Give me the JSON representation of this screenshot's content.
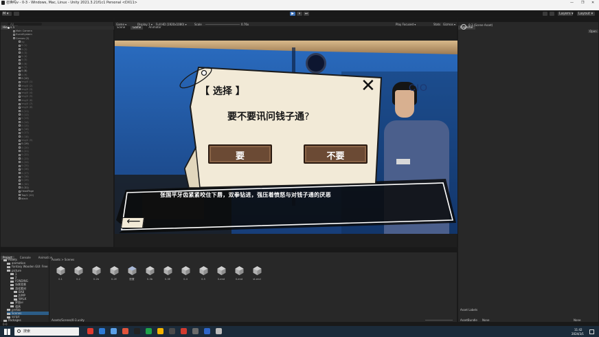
{
  "window": {
    "title": "召唤吗v - 0-3 - Windows, Mac, Linux - Unity 2021.3.21f1c1 Personal <DX11>",
    "controls": [
      "—",
      "❐",
      "✕"
    ]
  },
  "menu": [
    "File",
    "Edit",
    "Assets",
    "GameObject",
    "Component",
    "Jobs",
    "Window",
    "Help"
  ],
  "toolbar": {
    "account": "M ▾",
    "play": "▶",
    "pause": "⏸",
    "step": "⏭",
    "layers": "Layers ▾",
    "layout": "Layout ▾"
  },
  "hierarchy": {
    "tab": "Hierarchy",
    "search_placeholder": "All",
    "scene": "0-3",
    "rows": [
      {
        "label": "Main Camera",
        "dim": false
      },
      {
        "label": "EventSystem",
        "dim": false
      },
      {
        "label": "Canvas (2)",
        "dim": false
      },
      {
        "label": "bg",
        "dim": true
      },
      {
        "label": "0 (1)",
        "dim": true
      },
      {
        "label": "0 (2)",
        "dim": true
      },
      {
        "label": "0 (3)",
        "dim": true
      },
      {
        "label": "0 (4)",
        "dim": true
      },
      {
        "label": "0 (5)",
        "dim": true
      },
      {
        "label": "0 (6)",
        "dim": true
      },
      {
        "label": "0 (7)",
        "dim": true
      },
      {
        "label": "0 (8)",
        "dim": false
      },
      {
        "label": "0 (9)",
        "dim": true
      },
      {
        "label": "0 (10)",
        "dim": false
      },
      {
        "label": "Img/0 (1)",
        "dim": true
      },
      {
        "label": "Img/0 (2)",
        "dim": true
      },
      {
        "label": "Img/0 (3)",
        "dim": true
      },
      {
        "label": "Img/0 (4)",
        "dim": true
      },
      {
        "label": "Img/0 (5)",
        "dim": true
      },
      {
        "label": "Img/0 (6)",
        "dim": true
      },
      {
        "label": "Img/0 (7)",
        "dim": true
      },
      {
        "label": "Img/0 (8)",
        "dim": true
      },
      {
        "label": "0 (11)",
        "dim": true
      },
      {
        "label": "0 (12)",
        "dim": true
      },
      {
        "label": "0 (13)",
        "dim": true
      },
      {
        "label": "0 (14)",
        "dim": true
      },
      {
        "label": "0 (15)",
        "dim": true
      },
      {
        "label": "0 (16)",
        "dim": true
      },
      {
        "label": "0 (17)",
        "dim": true
      },
      {
        "label": "0 (18)",
        "dim": true
      },
      {
        "label": "Img/0 (9)",
        "dim": true
      },
      {
        "label": "0 (19)",
        "dim": false
      },
      {
        "label": "0 (20)",
        "dim": true
      },
      {
        "label": "0 (21)",
        "dim": true
      },
      {
        "label": "0 (22)",
        "dim": true
      },
      {
        "label": "0 (23)",
        "dim": true
      },
      {
        "label": "0 (24)",
        "dim": true
      },
      {
        "label": "0 (25)",
        "dim": true
      },
      {
        "label": "0 (26)",
        "dim": true
      },
      {
        "label": "0 (27)",
        "dim": true
      },
      {
        "label": "0 (28)",
        "dim": true
      },
      {
        "label": "0 (29)",
        "dim": true
      },
      {
        "label": "0 (30)",
        "dim": true
      },
      {
        "label": "0 (31)",
        "dim": false
      },
      {
        "label": "HeadPage",
        "dim": false
      },
      {
        "label": "Tap/1 (12)",
        "dim": false
      },
      {
        "label": "black",
        "dim": false
      }
    ]
  },
  "center": {
    "tabs": [
      "Scene",
      "Game",
      "Animator"
    ],
    "game_toolbar": {
      "display": "Game ▾",
      "display_no": "Display 1 ▾",
      "resolution": "Full HD (1920x1080) ▾",
      "scale_label": "Scale",
      "scale_value": "0.76x",
      "play_mode": "Play Focused ▾",
      "stats": "Stats",
      "gizmos": "Gizmos ▾"
    }
  },
  "game": {
    "dialog": {
      "title": "【 选择 】",
      "question": "要不要讯问钱子通",
      "question_mark": "?",
      "yes": "要",
      "no": "不要",
      "close": "✕"
    },
    "narration": "张国平牙齿紧紧咬住下唇，双拳钻进，强压着愤怒与对钱子通的厌恶",
    "back": "⟵",
    "wall_text": "CIO"
  },
  "inspector": {
    "tab": "Inspector",
    "object": "0-3 (Scene Asset)",
    "open": "Open",
    "asset_labels": "Asset Labels",
    "asset_bundle": "AssetBundle",
    "bundle_value": "None",
    "variant": "None"
  },
  "project": {
    "tabs": [
      "Project",
      "Console",
      "Animation"
    ],
    "breadcrumb": "Assets > Scenes",
    "tree": [
      {
        "label": "Assets",
        "level": 0
      },
      {
        "label": "animation",
        "level": 1
      },
      {
        "label": "Fantasy Wooden GUI: Free",
        "level": 1
      },
      {
        "label": "picture",
        "level": 1
      },
      {
        "label": "1",
        "level": 2
      },
      {
        "label": "2",
        "level": 2
      },
      {
        "label": "FONDING",
        "level": 2
      },
      {
        "label": "场景背景",
        "level": 2
      },
      {
        "label": "游戏素材",
        "level": 2
      },
      {
        "label": "BAB",
        "level": 3
      },
      {
        "label": "JUMP",
        "level": 3
      },
      {
        "label": "WALK",
        "level": 3
      },
      {
        "label": "界面ui",
        "level": 2
      },
      {
        "label": "道具",
        "level": 2
      },
      {
        "label": "prefab",
        "level": 1
      },
      {
        "label": "Scenes",
        "level": 1
      },
      {
        "label": "script",
        "level": 1
      },
      {
        "label": "Packages",
        "level": 0
      }
    ],
    "assets": [
      "0-1",
      "0-2",
      "0-2b",
      "0-2E",
      "配置",
      "0-3b",
      "0-3E",
      "0-4",
      "0-5",
      "0-end",
      "0-end",
      "st-end"
    ],
    "footer_path": "Assets/Scenes/0-3.unity",
    "status": "0-0",
    "count": "12"
  },
  "taskbar": {
    "search": "搜索",
    "time": "11:42",
    "date": "2024/3/1"
  },
  "colors": {
    "dialog_bg": "#f2ead7",
    "button_wood": "#6b4a34",
    "narration_bg": "#ffffff",
    "game_bg": "#1d4c8f"
  }
}
